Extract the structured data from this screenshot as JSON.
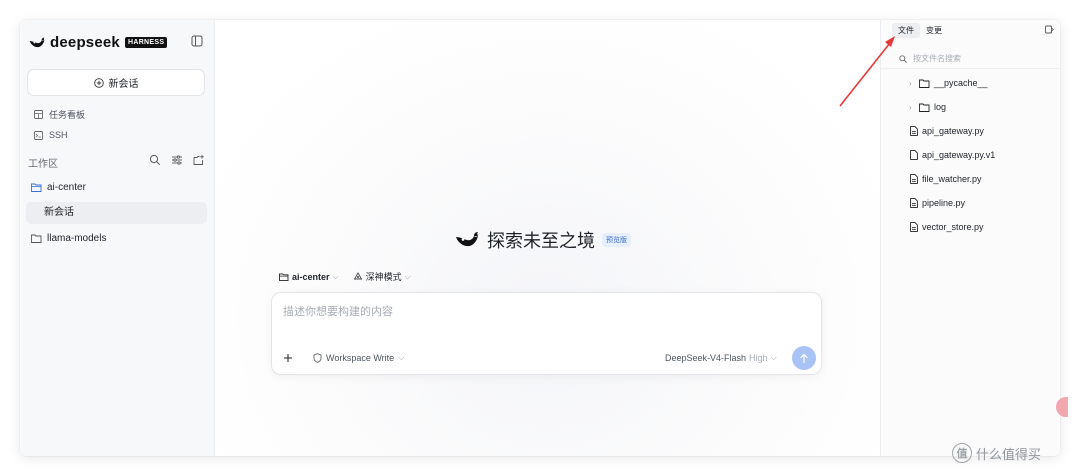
{
  "brand": {
    "name": "deepseek",
    "badge": "HARNESS"
  },
  "sidebar": {
    "new_chat": "新会话",
    "nav": [
      {
        "label": "任务看板",
        "icon": "kanban-icon"
      },
      {
        "label": "SSH",
        "icon": "terminal-icon"
      }
    ],
    "workspace_label": "工作区",
    "projects": [
      {
        "name": "ai-center",
        "open": true,
        "sessions": [
          "新会话"
        ]
      },
      {
        "name": "llama-models",
        "open": false
      }
    ]
  },
  "main": {
    "hero_title": "探索未至之境",
    "hero_badge": "预览版",
    "context": {
      "project": "ai-center",
      "mode": "深神模式"
    },
    "composer": {
      "placeholder": "描述你想要构建的内容",
      "permission": "Workspace Write",
      "model": "DeepSeek-V4-Flash",
      "level": "High"
    }
  },
  "right_panel": {
    "tabs": [
      "文件",
      "变更"
    ],
    "active_tab": "文件",
    "search_placeholder": "按文件名搜索",
    "files": [
      {
        "name": "__pycache__",
        "type": "folder"
      },
      {
        "name": "log",
        "type": "folder"
      },
      {
        "name": "api_gateway.py",
        "type": "file"
      },
      {
        "name": "api_gateway.py.v1",
        "type": "file"
      },
      {
        "name": "file_watcher.py",
        "type": "file"
      },
      {
        "name": "pipeline.py",
        "type": "file"
      },
      {
        "name": "vector_store.py",
        "type": "file"
      }
    ]
  },
  "watermark": {
    "text": "什么值得买",
    "glyph": "值"
  },
  "colors": {
    "accent": "#3a6ed8",
    "send": "#a9c3f7",
    "annotation": "#e53935"
  }
}
